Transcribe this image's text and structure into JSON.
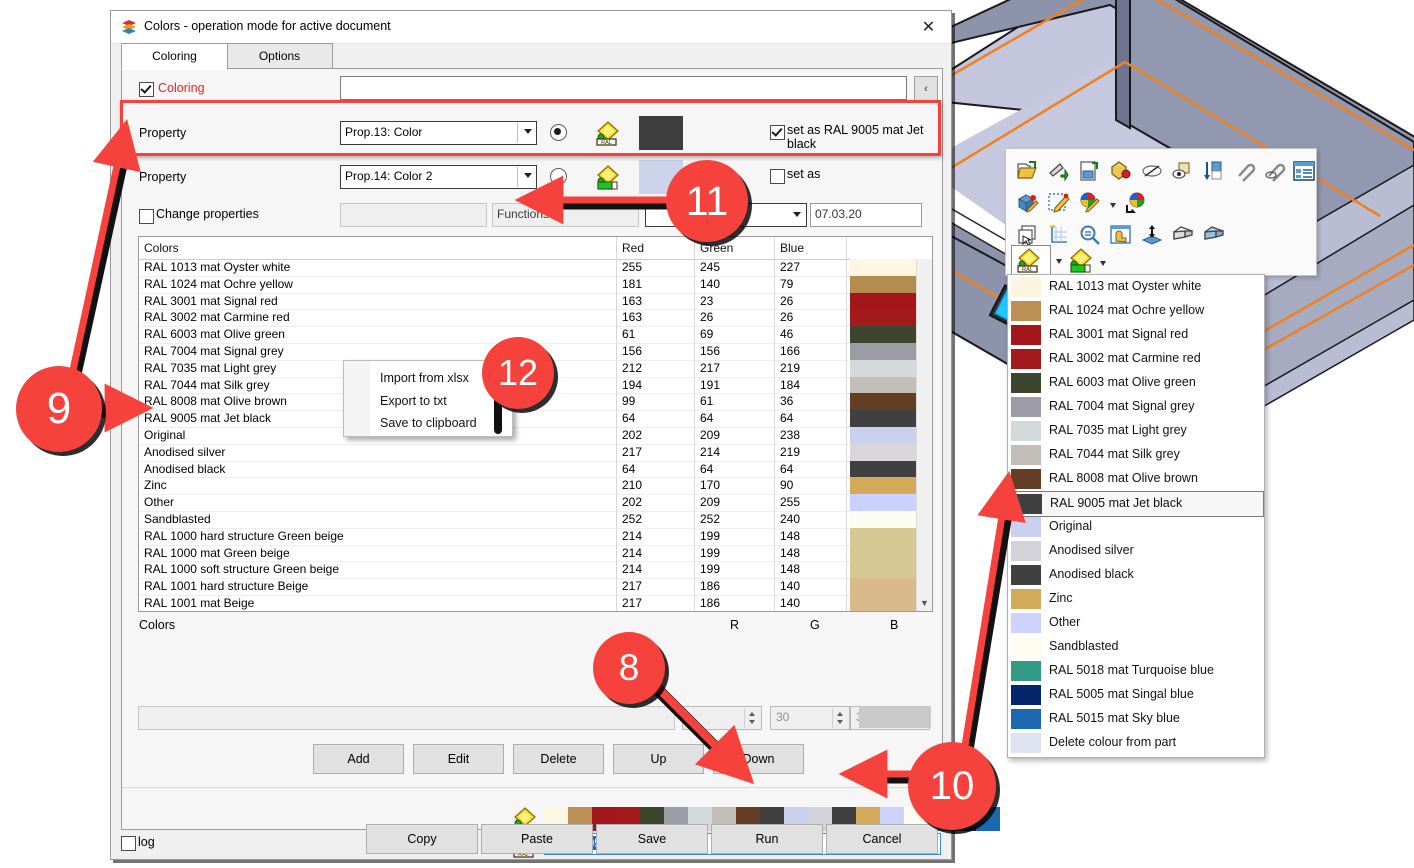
{
  "window": {
    "title": "Colors - operation mode for active document",
    "close_label": "✕",
    "icon": "layers-icon"
  },
  "tabs": [
    {
      "label": "Coloring",
      "active": true
    },
    {
      "label": "Options",
      "active": false
    }
  ],
  "coloring": {
    "checkbox_label": "Coloring",
    "checked": true,
    "input_value": "",
    "collapse_label": "‹"
  },
  "properties": [
    {
      "label": "Property",
      "select_value": "Prop.13: Color",
      "radio_selected": true,
      "color_chip": "#3d3d3d",
      "setas_checked": true,
      "setas_label": "set as RAL 9005 mat Jet black",
      "ral_icon": "ral-palette-icon"
    },
    {
      "label": "Property",
      "select_value": "Prop.14: Color 2",
      "radio_selected": false,
      "color_chip": "#ccd3ea",
      "setas_checked": false,
      "setas_label": "set as",
      "ral_icon": "ral-green-palette-icon"
    }
  ],
  "change_properties": {
    "label": "Change properties",
    "checked": false,
    "field1_value": "",
    "field2_value": "Functions",
    "combo_value": "",
    "date_value": "07.03.20"
  },
  "table": {
    "headers": [
      "Colors",
      "Red",
      "Green",
      "Blue"
    ],
    "rows": [
      {
        "name": "RAL 1013 mat Oyster white",
        "r": 255,
        "g": 245,
        "b": 227,
        "hex": "#fff5e3"
      },
      {
        "name": "RAL 1024 mat Ochre yellow",
        "r": 181,
        "g": 140,
        "b": 79,
        "hex": "#b58c4f"
      },
      {
        "name": "RAL 3001 mat Signal red",
        "r": 163,
        "g": 23,
        "b": 26,
        "hex": "#a3171a"
      },
      {
        "name": "RAL 3002 mat Carmine red",
        "r": 163,
        "g": 26,
        "b": 26,
        "hex": "#a31a1a"
      },
      {
        "name": "RAL 6003 mat Olive green",
        "r": 61,
        "g": 69,
        "b": 46,
        "hex": "#3d452e"
      },
      {
        "name": "RAL 7004 mat Signal grey",
        "r": 156,
        "g": 156,
        "b": 166,
        "hex": "#9c9ca6"
      },
      {
        "name": "RAL 7035 mat Light grey",
        "r": 212,
        "g": 217,
        "b": 219,
        "hex": "#d4d9db"
      },
      {
        "name": "RAL 7044 mat Silk grey",
        "r": 194,
        "g": 191,
        "b": 184,
        "hex": "#c2bfb8"
      },
      {
        "name": "RAL 8008 mat Olive brown",
        "r": 99,
        "g": 61,
        "b": 36,
        "hex": "#633d24"
      },
      {
        "name": "RAL 9005 mat Jet black",
        "r": 64,
        "g": 64,
        "b": 64,
        "hex": "#404040"
      },
      {
        "name": "Original",
        "r": 202,
        "g": 209,
        "b": 238,
        "hex": "#cad1ee"
      },
      {
        "name": "Anodised silver",
        "r": 217,
        "g": 214,
        "b": 219,
        "hex": "#d9d6db"
      },
      {
        "name": "Anodised black",
        "r": 64,
        "g": 64,
        "b": 64,
        "hex": "#404040"
      },
      {
        "name": "Zinc",
        "r": 210,
        "g": 170,
        "b": 90,
        "hex": "#d2aa5a"
      },
      {
        "name": "Other",
        "r": 202,
        "g": 209,
        "b": 255,
        "hex": "#cad1ff"
      },
      {
        "name": "Sandblasted",
        "r": 252,
        "g": 252,
        "b": 240,
        "hex": "#fcfcf0"
      },
      {
        "name": "RAL 1000 hard structure Green beige",
        "r": 214,
        "g": 199,
        "b": 148,
        "hex": "#d6c794"
      },
      {
        "name": "RAL 1000 mat Green beige",
        "r": 214,
        "g": 199,
        "b": 148,
        "hex": "#d6c794"
      },
      {
        "name": "RAL 1000 soft structure Green beige",
        "r": 214,
        "g": 199,
        "b": 148,
        "hex": "#d6c794"
      },
      {
        "name": "RAL 1001 hard structure Beige",
        "r": 217,
        "g": 186,
        "b": 140,
        "hex": "#d9ba8c"
      },
      {
        "name": "RAL 1001 mat Beige",
        "r": 217,
        "g": 186,
        "b": 140,
        "hex": "#d9ba8c"
      }
    ]
  },
  "context_menu": {
    "items": [
      "Import from xlsx",
      "Export to txt",
      "Save to clipboard"
    ]
  },
  "editor": {
    "colors_label": "Colors",
    "name_value": "",
    "r_label": "R",
    "g_label": "G",
    "b_label": "B",
    "r_value": "",
    "g_value": "30",
    "b_value": "30",
    "preview_color": "#c9c9c9"
  },
  "action_buttons": [
    "Add",
    "Edit",
    "Delete",
    "Up",
    "Down"
  ],
  "palette_strip": [
    "#fdf6e3",
    "#bc9055",
    "#a3171a",
    "#a31a1a",
    "#3d452e",
    "#9c9ca6",
    "#d4d9db",
    "#c2bfb8",
    "#633d24",
    "#404040",
    "#cad1ee",
    "#d4d2da",
    "#404040",
    "#d2aa5a",
    "#ccd3ff",
    "#fdfdf0",
    "#339b84",
    "#04276b",
    "#1b68b0"
  ],
  "selected_color_name": "RAL 9005 mat Jet black",
  "footer": {
    "log_label": "log",
    "log_checked": false,
    "buttons": [
      "Copy",
      "Paste",
      "Save",
      "Run",
      "Cancel"
    ]
  },
  "dropdown": {
    "items": [
      {
        "label": "RAL 1013 mat Oyster white",
        "color": "#fdf5e2",
        "selected": false
      },
      {
        "label": "RAL 1024 mat Ochre yellow",
        "color": "#bc9055",
        "selected": false
      },
      {
        "label": "RAL 3001 mat Signal red",
        "color": "#a3171a",
        "selected": false
      },
      {
        "label": "RAL 3002 mat Carmine red",
        "color": "#a31a1a",
        "selected": false
      },
      {
        "label": "RAL 6003 mat Olive green",
        "color": "#3d452e",
        "selected": false
      },
      {
        "label": "RAL 7004 mat Signal grey",
        "color": "#9c9ca6",
        "selected": false
      },
      {
        "label": "RAL 7035 mat Light grey",
        "color": "#d4d9db",
        "selected": false
      },
      {
        "label": "RAL 7044 mat Silk grey",
        "color": "#c2bfb8",
        "selected": false
      },
      {
        "label": "RAL 8008 mat Olive brown",
        "color": "#633d24",
        "selected": false
      },
      {
        "label": "RAL 9005 mat Jet black",
        "color": "#404040",
        "selected": true
      },
      {
        "label": "Original",
        "color": "#cad1ee",
        "selected": false
      },
      {
        "label": "Anodised silver",
        "color": "#d4d2da",
        "selected": false
      },
      {
        "label": "Anodised black",
        "color": "#404040",
        "selected": false
      },
      {
        "label": "Zinc",
        "color": "#d2aa5a",
        "selected": false
      },
      {
        "label": "Other",
        "color": "#ccd3ff",
        "selected": false
      },
      {
        "label": "Sandblasted",
        "color": "#fdfdf0",
        "selected": false
      },
      {
        "label": "RAL 5018 mat Turquoise blue",
        "color": "#339b84",
        "selected": false
      },
      {
        "label": "RAL 5005 mat Singal blue",
        "color": "#04276b",
        "selected": false
      },
      {
        "label": "RAL 5015 mat Sky blue",
        "color": "#1b68b0",
        "selected": false
      },
      {
        "label": "Delete colour from part",
        "color": "#dfe3ef",
        "selected": false
      }
    ]
  },
  "toolbar": {
    "rows": [
      [
        "open-folder-icon",
        "paint-roller-icon",
        "export-image-icon",
        "paint-can-icon",
        "hide-edge-icon",
        "show-hidden-icon",
        "sort-down-icon",
        "attach-clip-icon",
        "detach-clip-icon",
        "list-properties-icon"
      ],
      [
        "edit-part-color-icon",
        "edit-sketch-icon",
        "palette-edit-icon",
        "palette-dropdown-arrow",
        "palette-apply-icon"
      ],
      [
        "copy-select-icon",
        "new-sketch-icon",
        "zoom-fit-icon",
        "texture-icon",
        "extrude-icon",
        "box-face-icon",
        "box-shade-icon"
      ],
      [
        "ral-palette-active-icon",
        "ral-dropdown-arrow",
        "ral-green-palette-icon",
        "ral-green-dropdown-arrow"
      ]
    ]
  },
  "callouts": [
    {
      "number": "8"
    },
    {
      "number": "9"
    },
    {
      "number": "10"
    },
    {
      "number": "11"
    },
    {
      "number": "12"
    }
  ],
  "colors": {
    "accent_red": "#f6423c",
    "highlight_blue": "#0a6ed1",
    "coloring_label_red": "#ee2222"
  }
}
